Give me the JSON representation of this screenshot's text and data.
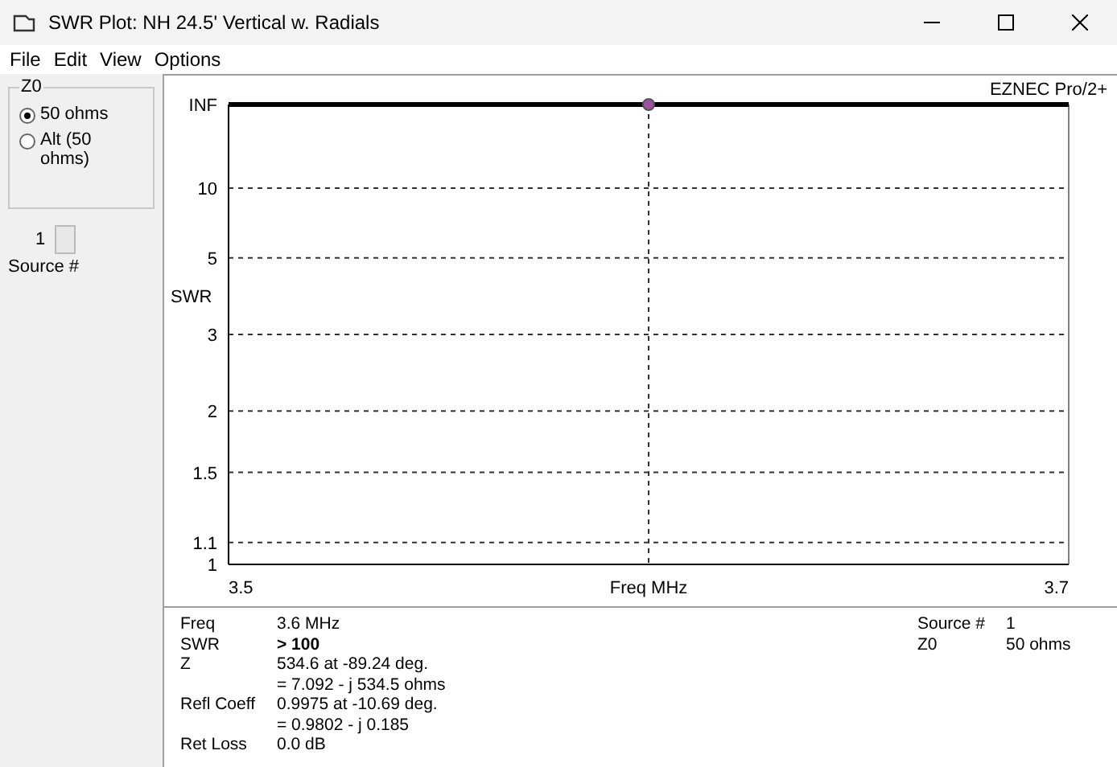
{
  "window": {
    "title": "SWR Plot: NH 24.5' Vertical w. Radials"
  },
  "menu": [
    "File",
    "Edit",
    "View",
    "Options"
  ],
  "z0_group": {
    "label": "Z0",
    "options": [
      {
        "label": "50 ohms",
        "selected": true
      },
      {
        "label": "Alt (50 ohms)",
        "selected": false
      }
    ]
  },
  "source_spinner": {
    "value": "1",
    "label": "Source #"
  },
  "plot": {
    "brand": "EZNEC Pro/2+",
    "y_axis_label": "SWR",
    "y_tick_labels": [
      "INF",
      "10",
      "5",
      "3",
      "2",
      "1.5",
      "1.1",
      "1"
    ],
    "x_tick_labels": [
      "3.5",
      "3.7"
    ],
    "x_axis_label": "Freq MHz"
  },
  "readout": {
    "left": [
      {
        "label": "Freq",
        "value": "3.6 MHz",
        "bold": false
      },
      {
        "label": "SWR",
        "value": "> 100",
        "bold": true
      },
      {
        "label": "Z",
        "value": "534.6 at -89.24 deg.",
        "bold": false
      },
      {
        "value": "= 7.092 - j 534.5 ohms",
        "bold": false
      },
      {
        "label": "Refl Coeff",
        "value": "0.9975 at -10.69 deg.",
        "bold": false
      },
      {
        "value": "= 0.9802 - j 0.185",
        "bold": false
      },
      {
        "label": "Ret Loss",
        "value": "0.0 dB",
        "bold": false
      }
    ],
    "right": [
      {
        "label": "Source #",
        "value": "1",
        "bold": false
      },
      {
        "label": "Z0",
        "value": "50 ohms",
        "bold": false
      }
    ]
  }
}
